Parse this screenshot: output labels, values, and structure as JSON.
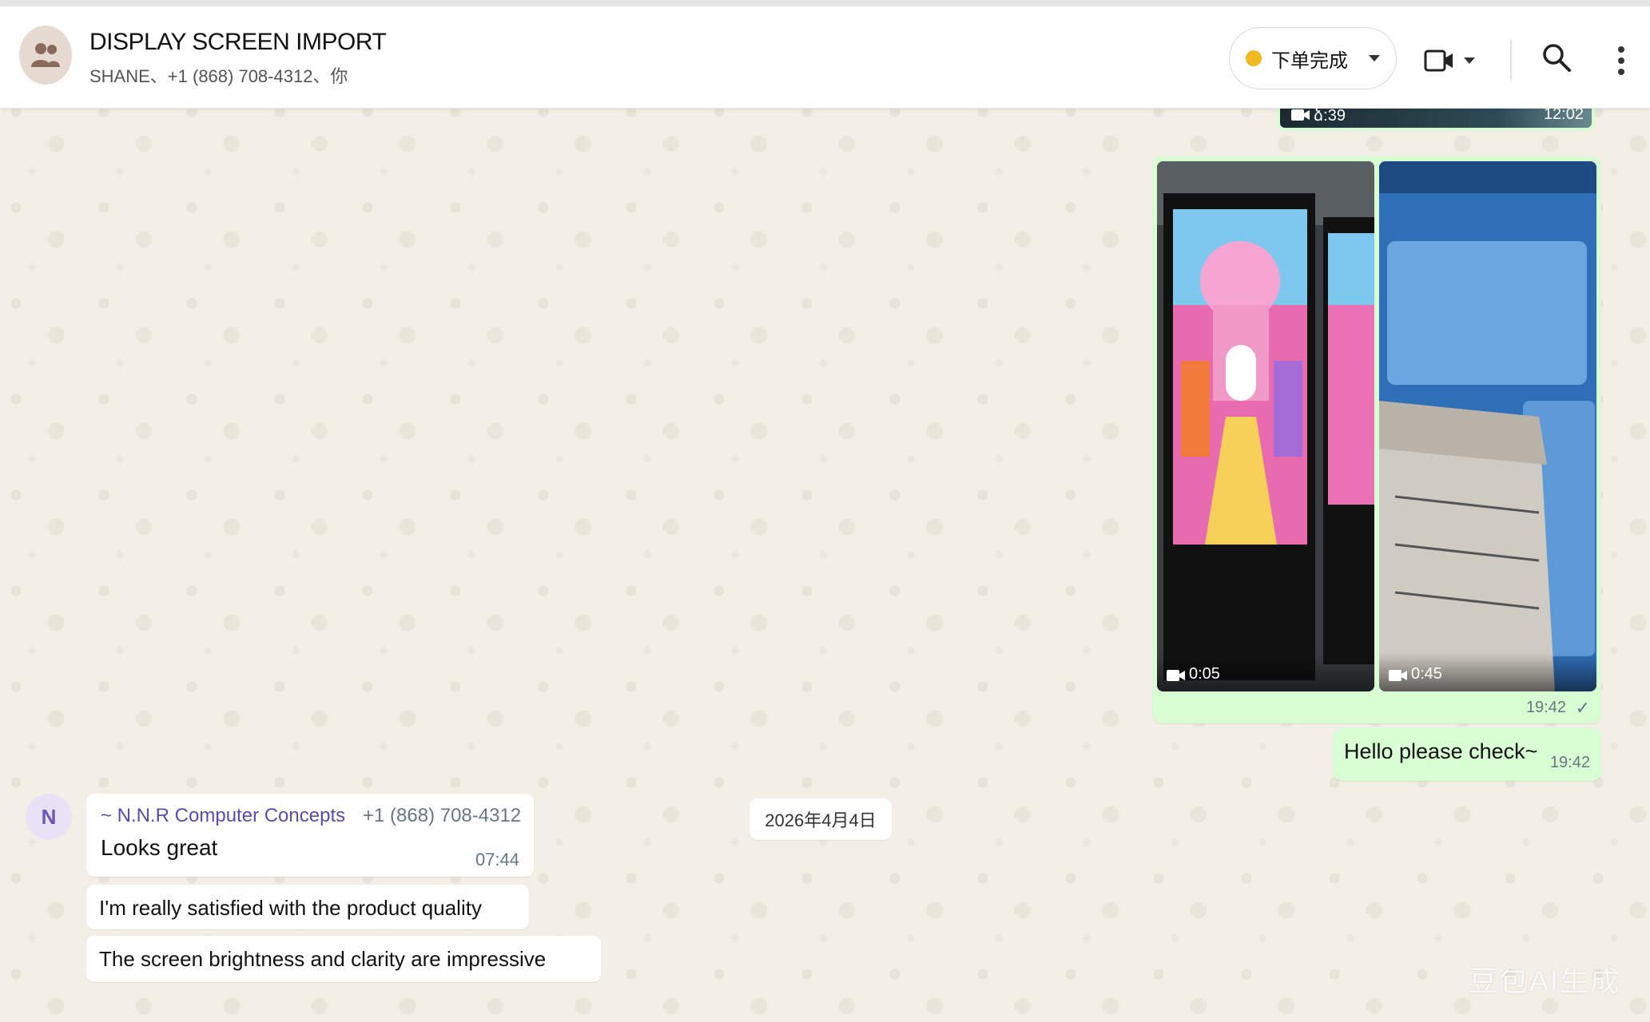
{
  "header": {
    "title": "DISPLAY SCREEN IMPORT",
    "subtitle": "SHANE、+1 (868) 708-4312、你",
    "label": "下单完成",
    "label_color": "#f1b91d"
  },
  "messages": {
    "previous_video": {
      "duration": "ձ:39",
      "time": "12:02"
    },
    "media": {
      "videos": [
        {
          "duration": "0:05"
        },
        {
          "duration": "0:45"
        }
      ],
      "time": "19:42",
      "status_icon": "✓"
    },
    "outgoing_text": {
      "text": "Hello please check~",
      "time": "19:42"
    },
    "date_divider": "2026年4月4日",
    "incoming": {
      "avatar_letter": "N",
      "sender_name": "~ N.N.R Computer Concepts",
      "sender_phone": "+1 (868) 708-4312",
      "first_text": "Looks great",
      "first_time": "07:44",
      "second_text": "I'm really satisfied with the product quality",
      "third_text": "The screen brightness and clarity are impressive"
    }
  },
  "watermark": "豆包AI生成",
  "colors": {
    "outgoing_bubble": "#d9fdd3",
    "incoming_bubble": "#ffffff",
    "sender_name": "#5a4bb0",
    "background": "#efeae2"
  },
  "icons": {
    "avatar": "group-avatar-icon",
    "video_call": "video-call-icon",
    "search": "search-icon",
    "menu": "more-vertical-icon",
    "video_thumb": "video-camera-icon"
  }
}
